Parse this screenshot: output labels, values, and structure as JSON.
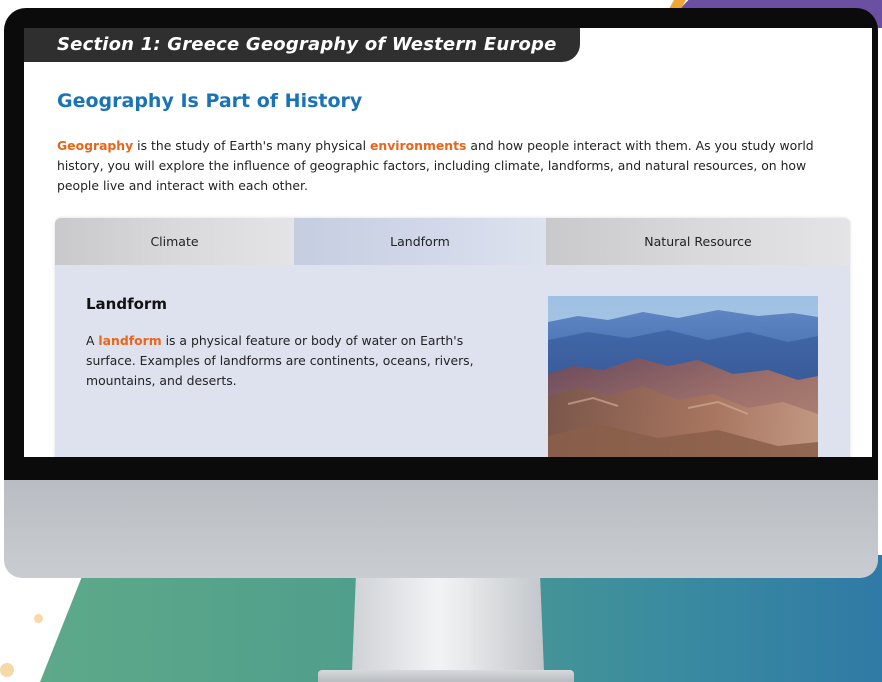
{
  "screen": {
    "section_banner": "Section 1: Greece Geography of Western Europe",
    "heading": "Geography Is Part of History",
    "intro": {
      "keyword1": "Geography",
      "text1": " is the study of Earth's many physical ",
      "keyword2": "environments",
      "text2": " and how people interact with them. As you study world history, you will explore the influence of geographic factors, including climate, landforms, and natural resources, on how people live and interact with each other."
    },
    "tabs": [
      {
        "label": "Climate",
        "active": false
      },
      {
        "label": "Landform",
        "active": true
      },
      {
        "label": "Natural Resource",
        "active": false
      }
    ],
    "panel": {
      "title": "Landform",
      "text_prefix": "A ",
      "keyword": "landform",
      "text_suffix": " is a physical feature or body of water on Earth's surface. Examples of landforms are continents, oceans, rivers, mountains, and deserts.",
      "image_icon": "mountain-landscape-photo"
    }
  },
  "colors": {
    "heading_blue": "#1a73b8",
    "keyword_orange": "#e8661c",
    "banner_dark": "#2f2f2f",
    "panel_bg": "#dde2ee"
  }
}
